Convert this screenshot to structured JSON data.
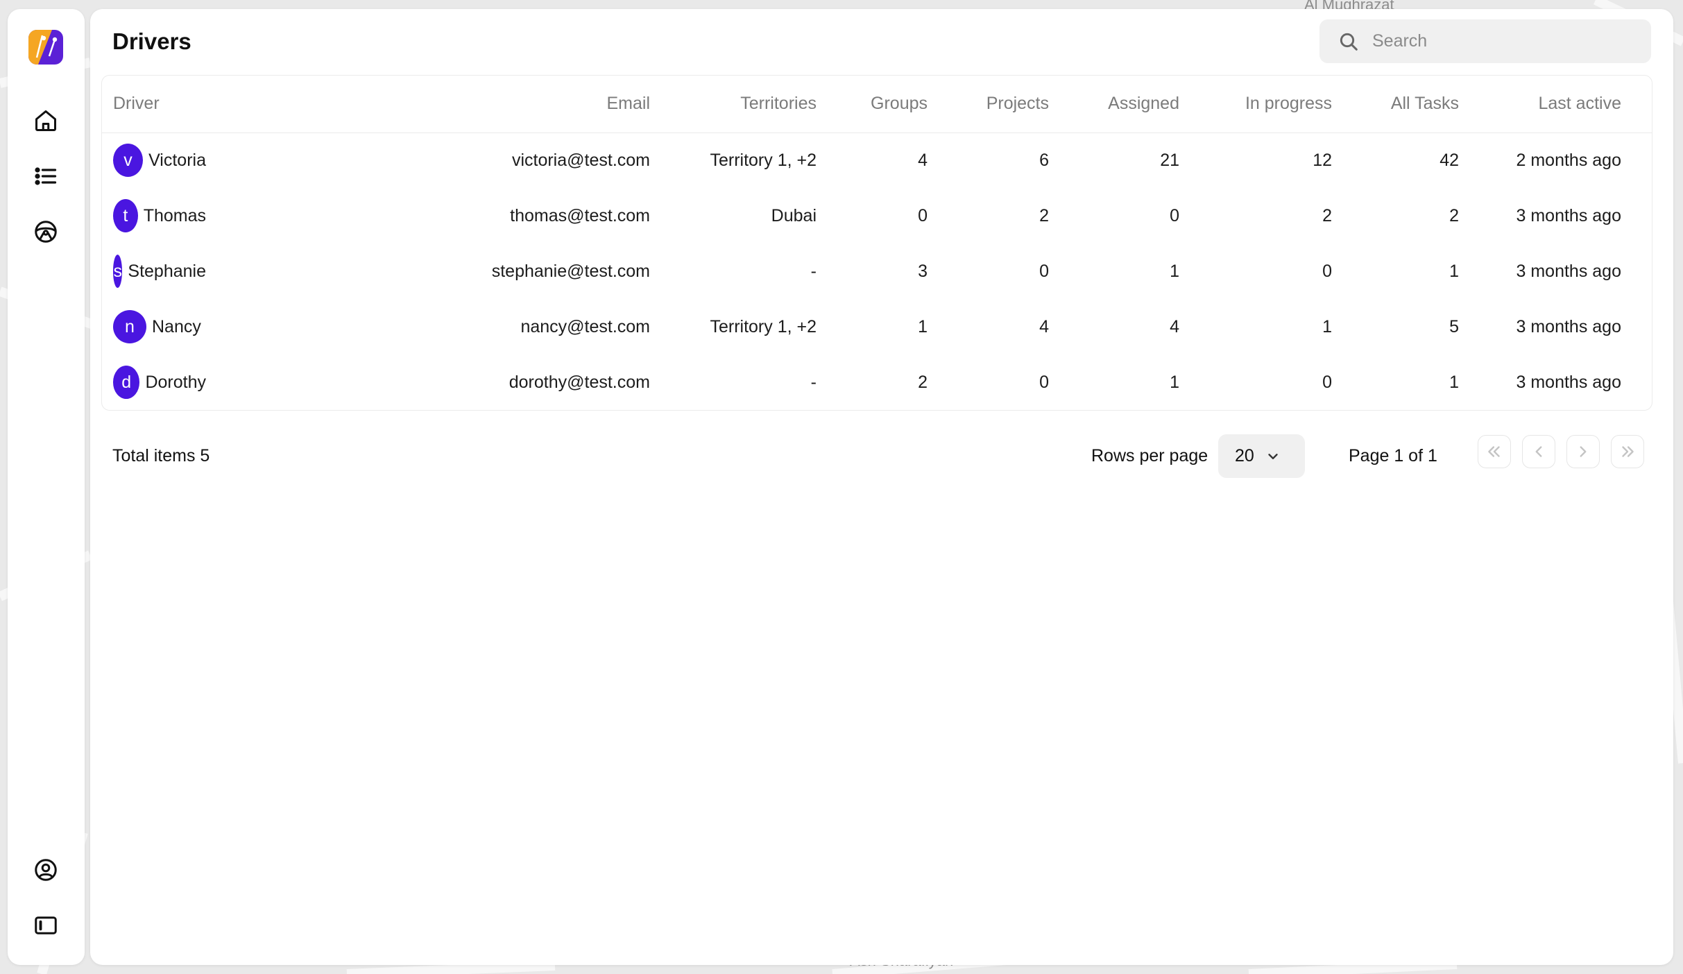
{
  "map": {
    "labels": [
      "Al Mughrazat",
      "Ash Sharafiyah"
    ]
  },
  "sidebar": {
    "logo": "app-logo",
    "nav": [
      {
        "icon": "home-icon"
      },
      {
        "icon": "list-icon"
      },
      {
        "icon": "steering-wheel-icon"
      }
    ],
    "bottom": [
      {
        "icon": "user-circle-icon"
      },
      {
        "icon": "sidebar-toggle-icon"
      }
    ]
  },
  "header": {
    "title": "Drivers",
    "search_placeholder": "Search"
  },
  "table": {
    "columns": [
      "Driver",
      "Email",
      "Territories",
      "Groups",
      "Projects",
      "Assigned",
      "In progress",
      "All Tasks",
      "Last active"
    ],
    "rows": [
      {
        "initial": "v",
        "name": "Victoria",
        "email": "victoria@test.com",
        "territories": "Territory 1, +2",
        "groups": "4",
        "projects": "6",
        "assigned": "21",
        "in_progress": "12",
        "all_tasks": "42",
        "last_active": "2 months ago"
      },
      {
        "initial": "t",
        "name": "Thomas",
        "email": "thomas@test.com",
        "territories": "Dubai",
        "groups": "0",
        "projects": "2",
        "assigned": "0",
        "in_progress": "2",
        "all_tasks": "2",
        "last_active": "3 months ago"
      },
      {
        "initial": "s",
        "name": "Stephanie",
        "email": "stephanie@test.com",
        "territories": "-",
        "groups": "3",
        "projects": "0",
        "assigned": "1",
        "in_progress": "0",
        "all_tasks": "1",
        "last_active": "3 months ago"
      },
      {
        "initial": "n",
        "name": "Nancy",
        "email": "nancy@test.com",
        "territories": "Territory 1, +2",
        "groups": "1",
        "projects": "4",
        "assigned": "4",
        "in_progress": "1",
        "all_tasks": "5",
        "last_active": "3 months ago"
      },
      {
        "initial": "d",
        "name": "Dorothy",
        "email": "dorothy@test.com",
        "territories": "-",
        "groups": "2",
        "projects": "0",
        "assigned": "1",
        "in_progress": "0",
        "all_tasks": "1",
        "last_active": "3 months ago"
      }
    ]
  },
  "footer": {
    "total_items": "Total items 5",
    "rows_per_page_label": "Rows per page",
    "rows_per_page_value": "20",
    "page_label": "Page 1 of 1",
    "pager": [
      "first-page-icon",
      "prev-page-icon",
      "next-page-icon",
      "last-page-icon"
    ]
  },
  "colors": {
    "avatar": "#4a16e0",
    "logo_orange": "#f5a623",
    "logo_purple": "#5b21d6"
  }
}
